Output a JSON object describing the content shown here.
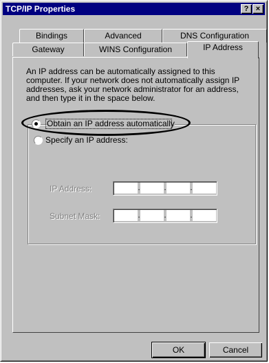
{
  "window": {
    "title": "TCP/IP Properties",
    "help_button": "?",
    "close_button": "×"
  },
  "tabs": {
    "back_row": [
      "Bindings",
      "Advanced",
      "DNS Configuration"
    ],
    "front_row": [
      "Gateway",
      "WINS Configuration",
      "IP Address"
    ],
    "selected": "IP Address"
  },
  "description": "An IP address can be automatically assigned to this computer. If your network does not automatically assign IP addresses, ask your network administrator for an address, and then type it in the space below.",
  "options": {
    "obtain_auto": {
      "label": "Obtain an IP address automatically",
      "selected": true
    },
    "specify": {
      "label": "Specify an IP address:",
      "selected": false
    }
  },
  "fields": {
    "ip_address": {
      "label": "IP Address:",
      "value": ""
    },
    "subnet_mask": {
      "label": "Subnet Mask:",
      "value": ""
    }
  },
  "buttons": {
    "ok": "OK",
    "cancel": "Cancel"
  },
  "colors": {
    "titlebar": "#000080",
    "face": "#c0c0c0",
    "annotation": "#000000"
  }
}
